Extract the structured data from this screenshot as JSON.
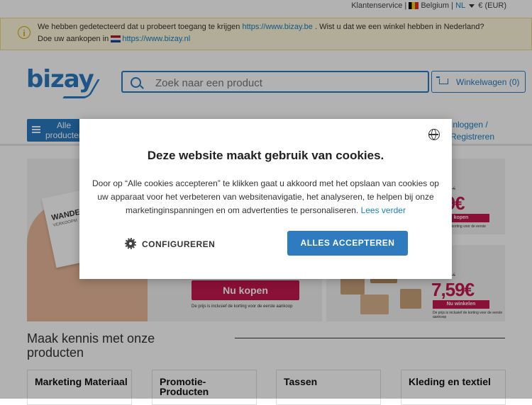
{
  "topbar": {
    "customer_service": "Klantenservice",
    "separator": "|",
    "country": "Belgium",
    "language": "NL",
    "currency": "€ (EUR)"
  },
  "notice": {
    "line1_pre": "We hebben gedetecteerd dat u probeert toegang te krijgen",
    "line1_link": "https://www.bizay.be",
    "line1_post": ". Wist u dat we een winkel hebben in Nederland?",
    "line2_pre": "Doe uw aankopen in",
    "line2_link": "https://www.bizay.nl"
  },
  "header": {
    "logo": "bizay",
    "search_placeholder": "Zoek naar een product",
    "cart_label": "Winkelwagen (0)"
  },
  "nav": {
    "all_products_l1": "Alle",
    "all_products_l2": "producten",
    "login_l1": "Inloggen /",
    "login_l2": "Registreren"
  },
  "banners": {
    "card_name": "WANDE",
    "card_sub": "VERKOOPM",
    "buy_button": "Nu kopen",
    "buy_note": "De prijs is inclusief de korting voor de eerste aankoop",
    "side1_title": "ers",
    "side1_old": "Van 32,19 €",
    "side1_price": ",49€",
    "side1_button": "kopen",
    "side1_note": "Inclusief de korting voor de eerste",
    "side2_title": "kers",
    "side2_old": "Van 15,99 €",
    "side2_price": "7,59€",
    "side2_button": "Nu winkelen",
    "side2_note": "De prijs is inclusief de korting voor de eerste aankoop"
  },
  "section": {
    "title_l1": "Maak kennis met onze",
    "title_l2": "producten",
    "categories": [
      "Marketing Materiaal",
      "Promotie-\nProducten",
      "Tassen",
      "Kleding en textiel"
    ]
  },
  "cookie_modal": {
    "title": "Deze website maakt gebruik van cookies.",
    "body": "Door op “Alle cookies accepteren” te klikken gaat u akkoord met het opslaan van cookies op uw apparaat voor het verbeteren van websitenavigatie, het analyseren, te helpen bij onze marketinginspanningen en om advertenties te personaliseren.",
    "read_more": "Lees verder",
    "configure_button": "CONFIGUREREN",
    "accept_button": "ALLES ACCEPTEREN"
  },
  "colors": {
    "brand_blue": "#2a7ac0",
    "accent_red": "#c5174e",
    "notice_bg": "#fff8dc"
  }
}
